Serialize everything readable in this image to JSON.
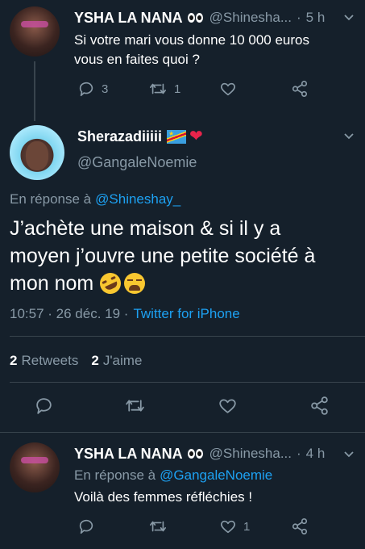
{
  "tweet1": {
    "display_name": "YSHA LA NANA",
    "handle": "@Shinesha...",
    "dot": "·",
    "time": "5 h",
    "text_line1": "Si votre mari vous donne 10 000 euros",
    "text_line2": "vous en faites quoi ?",
    "replies": "3",
    "retweets": "1",
    "name_emoji": "eyes-emoji"
  },
  "main": {
    "display_name": "Sherazadiiiii",
    "handle": "@GangaleNoemie",
    "reply_prefix": "En réponse à",
    "reply_to": "@Shineshay_",
    "text_line1": "J’achète une maison & si il y a",
    "text_line2": "moyen j’ouvre une petite société à",
    "text_line3": "mon nom",
    "timestamp": "10:57 · 26 déc. 19 ·",
    "source": "Twitter for iPhone",
    "retweet_count": "2",
    "retweet_label": "Retweets",
    "like_count": "2",
    "like_label": "J'aime",
    "name_emojis": [
      "congo-flag-emoji",
      "heart-emoji"
    ],
    "text_emojis": [
      "rolling-laughing-emoji",
      "weary-face-emoji"
    ]
  },
  "tweet2": {
    "display_name": "YSHA LA NANA",
    "handle": "@Shinesha...",
    "dot": "·",
    "time": "4 h",
    "reply_prefix": "En réponse à",
    "reply_to": "@GangaleNoemie",
    "text": "Voilà des femmes réfléchies !",
    "likes": "1"
  },
  "colors": {
    "background": "#15202b",
    "accent": "#1da1f2",
    "muted": "#8899a6",
    "divider": "#38444d"
  }
}
